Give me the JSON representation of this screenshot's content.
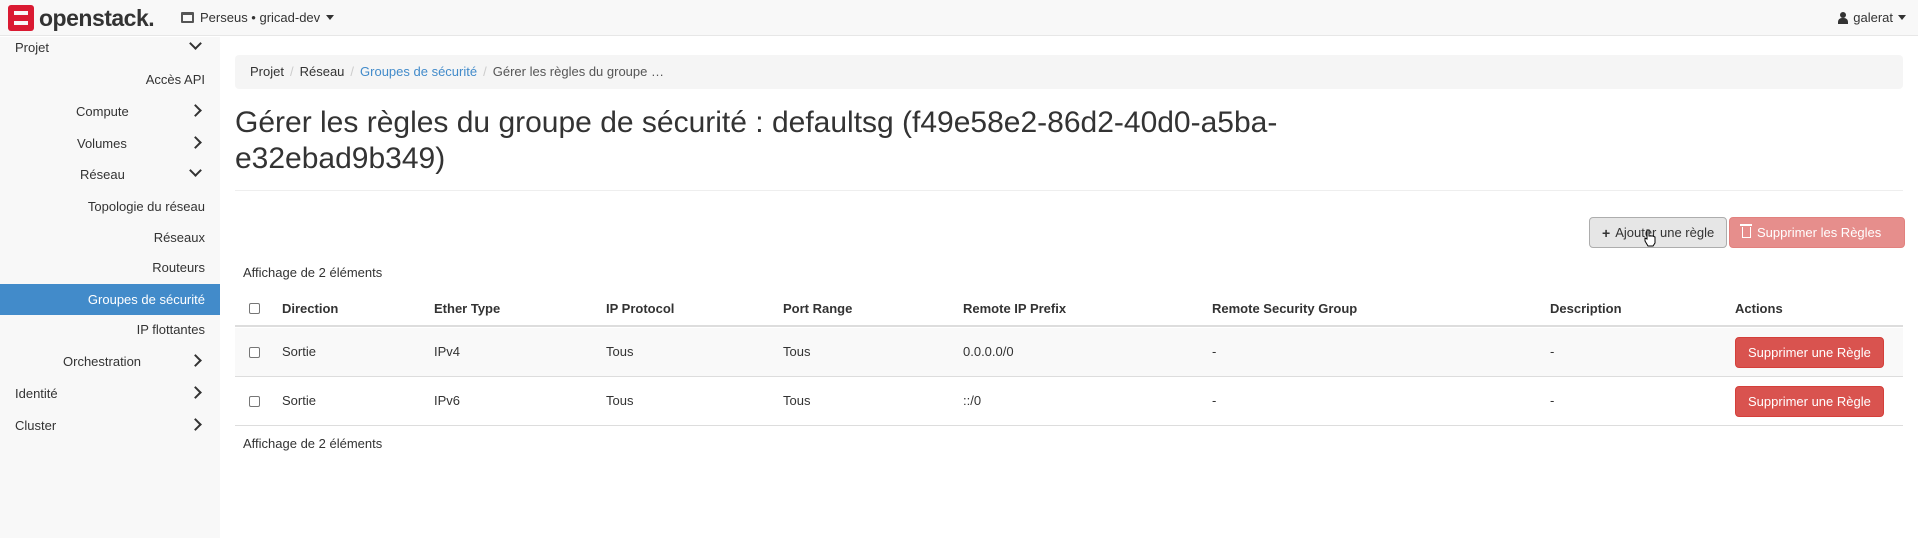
{
  "topbar": {
    "logo_text": "openstack.",
    "project": "Perseus • gricad-dev",
    "user": "galerat"
  },
  "sidebar": {
    "projet": "Projet",
    "acces_api": "Accès API",
    "compute": "Compute",
    "volumes": "Volumes",
    "reseau": "Réseau",
    "topologie": "Topologie du réseau",
    "reseaux": "Réseaux",
    "routeurs": "Routeurs",
    "groupes": "Groupes de sécurité",
    "ip_flottantes": "IP flottantes",
    "orchestration": "Orchestration",
    "identite": "Identité",
    "cluster": "Cluster"
  },
  "breadcrumb": {
    "items": [
      "Projet",
      "Réseau",
      "Groupes de sécurité",
      "Gérer les règles du groupe …"
    ],
    "sep": "/"
  },
  "page": {
    "title": "Gérer les règles du groupe de sécurité : defaultsg (f49e58e2-86d2-40d0-a5ba-e32ebad9b349)",
    "add_rule": "Ajouter une règle",
    "delete_rules": "Supprimer les Règles",
    "count_top": "Affichage de 2 éléments",
    "count_bottom": "Affichage de 2 éléments"
  },
  "table": {
    "headers": [
      "Direction",
      "Ether Type",
      "IP Protocol",
      "Port Range",
      "Remote IP Prefix",
      "Remote Security Group",
      "Description",
      "Actions"
    ],
    "rows": [
      {
        "direction": "Sortie",
        "ether": "IPv4",
        "proto": "Tous",
        "port": "Tous",
        "prefix": "0.0.0.0/0",
        "group": "-",
        "desc": "-",
        "action": "Supprimer une Règle"
      },
      {
        "direction": "Sortie",
        "ether": "IPv6",
        "proto": "Tous",
        "port": "Tous",
        "prefix": "::/0",
        "group": "-",
        "desc": "-",
        "action": "Supprimer une Règle"
      }
    ]
  },
  "colors": {
    "accent": "#428bca",
    "danger": "#d9534f",
    "brand": "#da1a32"
  }
}
